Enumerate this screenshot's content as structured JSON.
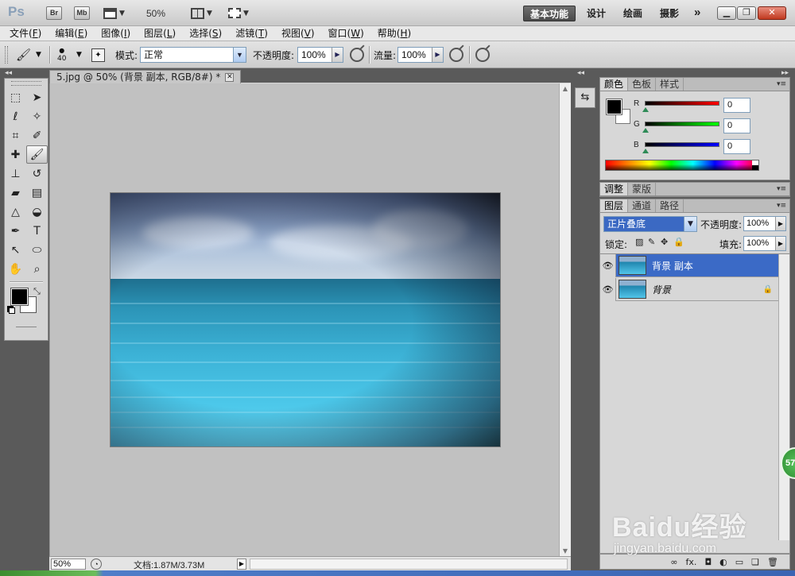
{
  "app": {
    "logo": "Ps",
    "bridge_buttons": [
      "Br",
      "Mb"
    ],
    "zoom": "50%",
    "workspaces": [
      "基本功能",
      "设计",
      "绘画",
      "摄影"
    ],
    "active_workspace": "基本功能",
    "more": "»",
    "window_controls": [
      "minimize-icon",
      "restore-icon",
      "close-icon"
    ]
  },
  "menu": [
    {
      "label": "文件(",
      "key": "F",
      "end": ")"
    },
    {
      "label": "编辑(",
      "key": "E",
      "end": ")"
    },
    {
      "label": "图像(",
      "key": "I",
      "end": ")"
    },
    {
      "label": "图层(",
      "key": "L",
      "end": ")"
    },
    {
      "label": "选择(",
      "key": "S",
      "end": ")"
    },
    {
      "label": "滤镜(",
      "key": "T",
      "end": ")"
    },
    {
      "label": "视图(",
      "key": "V",
      "end": ")"
    },
    {
      "label": "窗口(",
      "key": "W",
      "end": ")"
    },
    {
      "label": "帮助(",
      "key": "H",
      "end": ")"
    }
  ],
  "options": {
    "brush_size": "40",
    "mode_label": "模式:",
    "mode_value": "正常",
    "opacity_label": "不透明度:",
    "opacity_value": "100%",
    "flow_label": "流量:",
    "flow_value": "100%"
  },
  "document": {
    "tab_title": "5.jpg @ 50% (背景 副本, RGB/8#) *",
    "zoom": "50%",
    "doc_info": "文档:1.87M/3.73M"
  },
  "tools": [
    [
      "marquee-icon",
      "move-icon"
    ],
    [
      "lasso-icon",
      "quick-select-icon"
    ],
    [
      "crop-icon",
      "eyedropper-icon"
    ],
    [
      "healing-icon",
      "brush-icon"
    ],
    [
      "stamp-icon",
      "history-brush-icon"
    ],
    [
      "eraser-icon",
      "gradient-icon"
    ],
    [
      "blur-icon",
      "dodge-icon"
    ],
    [
      "pen-icon",
      "type-icon"
    ],
    [
      "path-select-icon",
      "shape-icon"
    ],
    [
      "hand-icon",
      "zoom-icon"
    ]
  ],
  "active_tool": "brush-icon",
  "colors": {
    "foreground": "#000000",
    "background": "#ffffff",
    "selection": "#3b6ac6"
  },
  "color_panel": {
    "tabs": [
      "颜色",
      "色板",
      "样式"
    ],
    "active_tab": "颜色",
    "channels": [
      {
        "label": "R",
        "value": "0",
        "gradient": "linear-gradient(90deg,#000,#f00)"
      },
      {
        "label": "G",
        "value": "0",
        "gradient": "linear-gradient(90deg,#000,#0f0)"
      },
      {
        "label": "B",
        "value": "0",
        "gradient": "linear-gradient(90deg,#000,#00f)"
      }
    ]
  },
  "adjust_panel": {
    "tabs": [
      "调整",
      "蒙版"
    ],
    "active_tab": "调整"
  },
  "layers_panel": {
    "tabs": [
      "图层",
      "通道",
      "路径"
    ],
    "active_tab": "图层",
    "blend_mode": "正片叠底",
    "opacity_label": "不透明度:",
    "opacity_value": "100%",
    "lock_label": "锁定:",
    "fill_label": "填充:",
    "fill_value": "100%",
    "layers": [
      {
        "name": "背景 副本",
        "selected": true,
        "locked": false
      },
      {
        "name": "背景",
        "selected": false,
        "locked": true
      }
    ]
  },
  "watermark": {
    "brand": "Baidu经验",
    "url": "jingyan.baidu.com"
  },
  "badge": "57"
}
